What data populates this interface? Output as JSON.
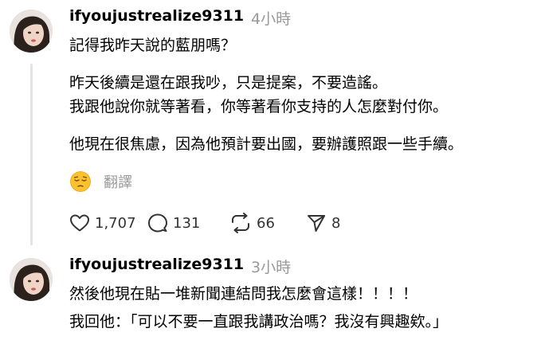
{
  "colors": {
    "text": "#000000",
    "muted": "#999999",
    "icon": "#333333",
    "thread_line": "#e3e3e3"
  },
  "posts": [
    {
      "username": "ifyoujustrealize9311",
      "time": "4小時",
      "lines": [
        "記得我昨天說的藍朋嗎？",
        "昨天後續是還在跟我吵，只是提案，不要造謠。",
        "我跟他說你就等著看，你等著看你支持的人怎麼對付你。",
        "他現在很焦慮，因為他預計要出國，要辦護照跟一些手續。"
      ],
      "translate_emoji": "pensive-face",
      "translate_label": "翻譯",
      "actions": {
        "likes": "1,707",
        "comments": "131",
        "reposts": "66",
        "shares": "8"
      }
    },
    {
      "username": "ifyoujustrealize9311",
      "time": "3小時",
      "lines": [
        "然後他現在貼一堆新聞連結問我怎麼會這樣！！！！",
        "我回他：「可以不要一直跟我講政治嗎？我沒有興趣欸。」"
      ]
    }
  ]
}
